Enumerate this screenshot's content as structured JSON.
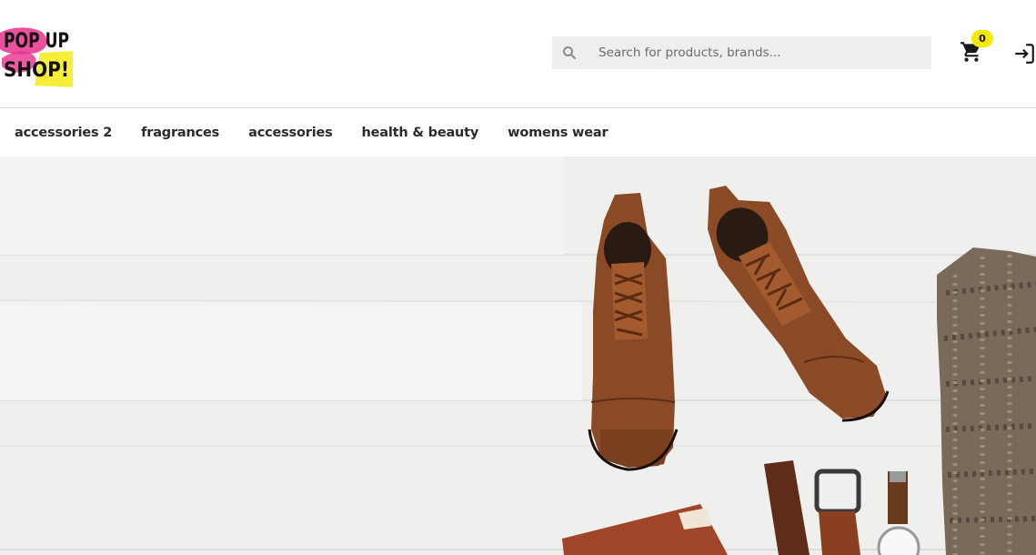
{
  "logo": {
    "alt": "POP UP SHOP!",
    "line1": "POP UP",
    "line2": "SHOP!"
  },
  "search": {
    "placeholder": "Search for products, brands...",
    "value": "",
    "icon": "search-icon"
  },
  "cart": {
    "count": "0",
    "icon": "cart-icon",
    "badge_color": "#f5e900"
  },
  "login": {
    "icon": "login-icon"
  },
  "nav": {
    "items": [
      {
        "label": "accessories 2"
      },
      {
        "label": "fragrances"
      },
      {
        "label": "accessories"
      },
      {
        "label": "health & beauty"
      },
      {
        "label": "womens wear"
      }
    ]
  },
  "hero": {
    "description": "flat lay of brown leather boots, belt, wristwatch and knit sweater on white wooden floor"
  }
}
